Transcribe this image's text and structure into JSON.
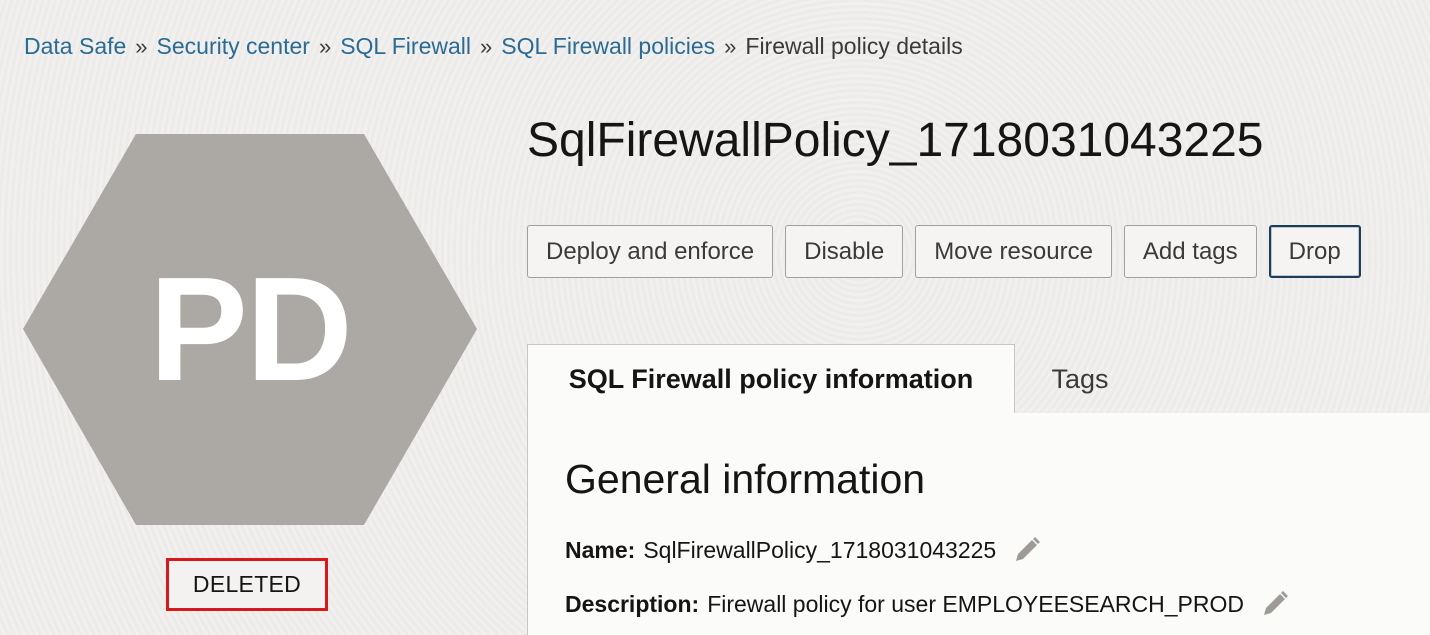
{
  "breadcrumb": [
    {
      "label": "Data Safe"
    },
    {
      "label": "Security center"
    },
    {
      "label": "SQL Firewall"
    },
    {
      "label": "SQL Firewall policies"
    }
  ],
  "breadcrumb_separator": "»",
  "breadcrumb_current": "Firewall policy details",
  "badge": {
    "initials": "PD",
    "color": "#aca8a4"
  },
  "status": {
    "label": "DELETED",
    "border_color": "#d7191c"
  },
  "title": "SqlFirewallPolicy_1718031043225",
  "actions": {
    "deploy": "Deploy and enforce",
    "disable": "Disable",
    "move": "Move resource",
    "add_tags": "Add tags",
    "drop": "Drop"
  },
  "tabs": {
    "info": "SQL Firewall policy information",
    "tags": "Tags"
  },
  "general": {
    "heading": "General information",
    "name_label": "Name:",
    "name_value": "SqlFirewallPolicy_1718031043225",
    "description_label": "Description:",
    "description_value": "Firewall policy for user EMPLOYEESEARCH_PROD"
  },
  "icons": {
    "edit": "pencil-icon",
    "separator": "double-chevron-right"
  }
}
